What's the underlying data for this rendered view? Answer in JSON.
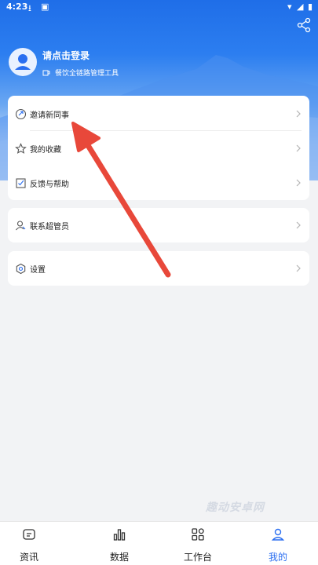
{
  "status_bar": {
    "time": "4:23"
  },
  "profile": {
    "login_prompt": "请点击登录",
    "subtitle": "餐饮全链路管理工具"
  },
  "menu_card_1": {
    "items": [
      {
        "label": "邀请新同事",
        "icon": "invite-icon"
      },
      {
        "label": "我的收藏",
        "icon": "star-icon"
      },
      {
        "label": "反馈与帮助",
        "icon": "feedback-icon"
      }
    ]
  },
  "menu_card_2": {
    "items": [
      {
        "label": "联系超管员",
        "icon": "contact-admin-icon"
      }
    ]
  },
  "menu_card_3": {
    "items": [
      {
        "label": "设置",
        "icon": "settings-icon"
      }
    ]
  },
  "watermark": "趣动安卓网",
  "tabs": [
    {
      "label": "资讯",
      "icon": "news-icon",
      "active": false
    },
    {
      "label": "数据",
      "icon": "data-chart-icon",
      "active": false
    },
    {
      "label": "工作台",
      "icon": "workbench-icon",
      "active": false
    },
    {
      "label": "我的",
      "icon": "profile-icon",
      "active": true
    }
  ],
  "colors": {
    "primary": "#2a6ef0",
    "arrow": "#e8483a",
    "background": "#f2f3f5"
  }
}
